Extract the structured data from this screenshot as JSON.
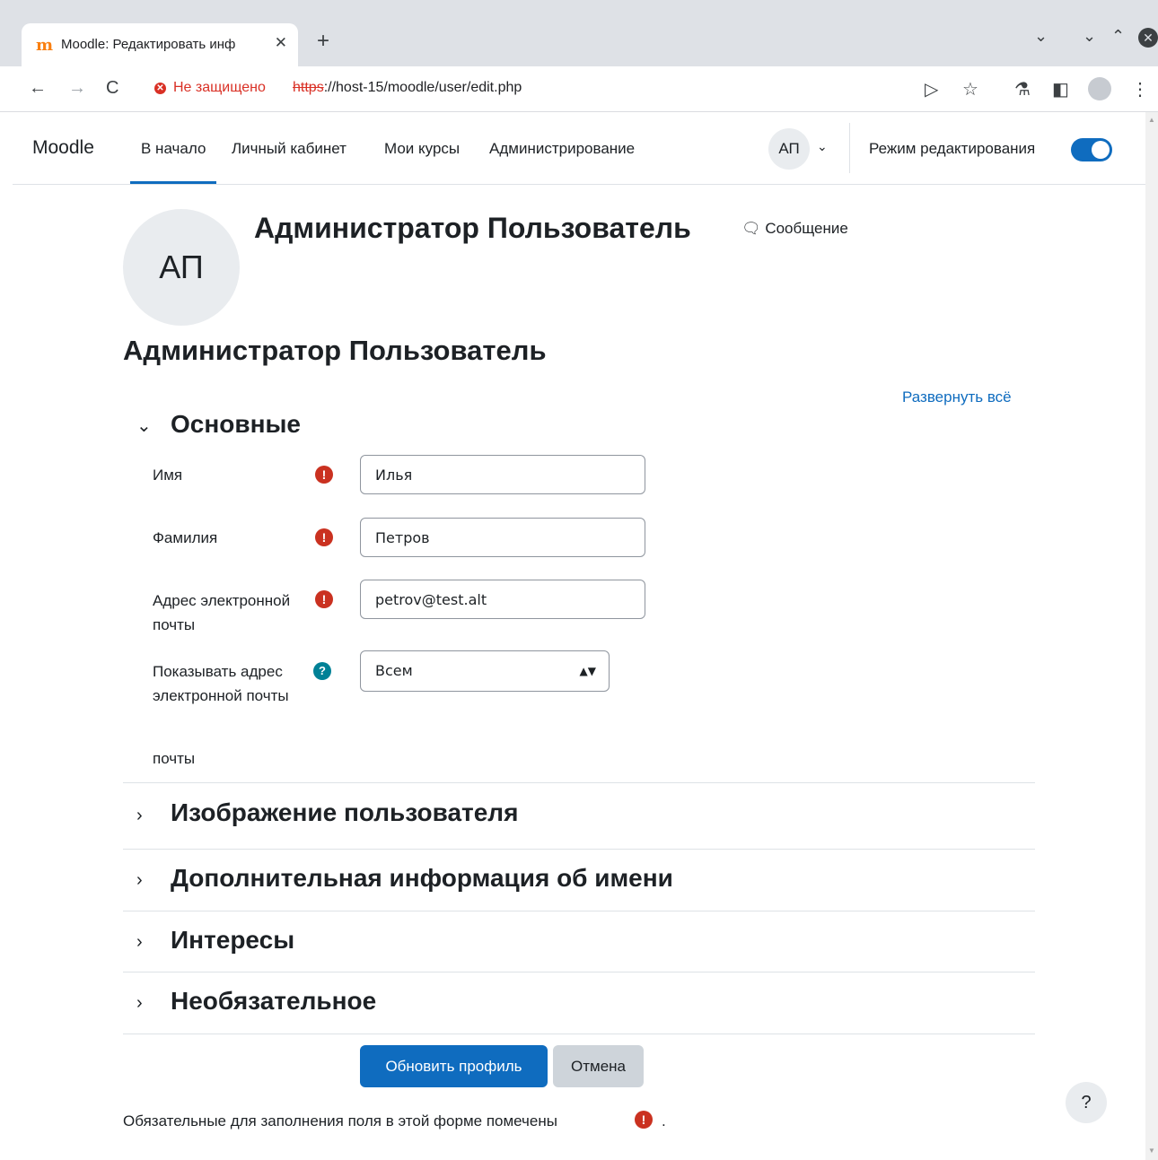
{
  "browser": {
    "tab_title": "Moodle: Редактировать инф",
    "tab_favicon": "m",
    "new_tab": "+",
    "security_text": "Не защищено",
    "url_scheme": "https",
    "url_rest": "://host-15/moodle/user/edit.php",
    "url_host": "host-15"
  },
  "nav": {
    "brand": "Moodle",
    "links": [
      "В начало",
      "Личный кабинет",
      "Мои курсы",
      "Администрирование"
    ],
    "user_initials": "АП",
    "edit_mode_label": "Режим редактирования"
  },
  "header": {
    "avatar_initials": "АП",
    "fullname": "Администратор Пользователь",
    "message_label": "Сообщение",
    "page_heading": "Администратор Пользователь",
    "expand_all": "Развернуть всё"
  },
  "form": {
    "section_general": "Основные",
    "first_name_label": "Имя",
    "first_name_value": "Илья",
    "last_name_label": "Фамилия",
    "last_name_value": "Петров",
    "email_label": "Адрес электронной почты",
    "email_value": "petrov@test.alt",
    "email_display_label": "Показывать адрес электронной почты",
    "email_display_extra": "почты",
    "email_display_value": "Всем",
    "sections": [
      "Изображение пользователя",
      "Дополнительная информация об имени",
      "Интересы",
      "Необязательное"
    ],
    "submit_label": "Обновить профиль",
    "cancel_label": "Отмена",
    "required_note": "Обязательные для заполнения поля в этой форме помечены",
    "required_note_end": "."
  },
  "help_button": "?",
  "colors": {
    "primary": "#0f6cbf",
    "required": "#ca3120",
    "help": "#008196"
  }
}
